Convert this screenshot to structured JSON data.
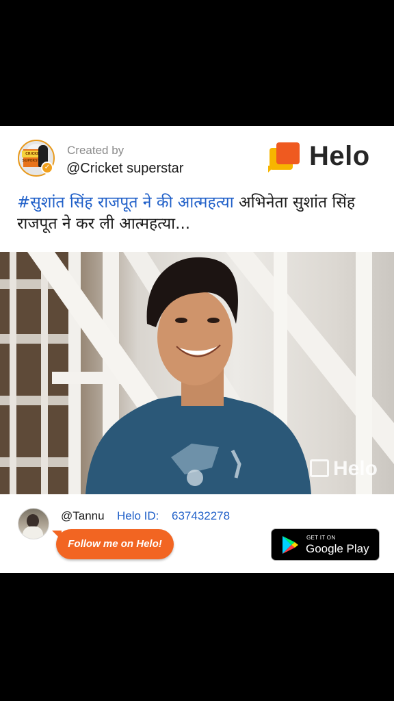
{
  "header": {
    "created_by_label": "Created by",
    "creator_handle": "@Cricket superstar",
    "avatar_banner_text": "CRICKET SUPERSTAR",
    "app_logo_text": "Helo"
  },
  "post": {
    "hashtag": "#सुशांत सिंह राजपूत ने की आत्महत्या",
    "caption_text": " अभिनेता सुशांत सिंह राजपूत ने कर ली आत्महत्या..."
  },
  "photo": {
    "watermark_text": "Helo"
  },
  "footer": {
    "user_handle": "@Tannu",
    "helo_id_label": "Helo ID:",
    "helo_id_value": "637432278",
    "follow_button_label": "Follow me on Helo!",
    "store_badge_top": "GET IT ON",
    "store_badge_name": "Google Play"
  },
  "colors": {
    "accent_orange": "#f26522",
    "link_blue": "#1f5fc8",
    "background": "#000000",
    "card": "#ffffff"
  },
  "icons": [
    "helo-logo-icon",
    "verified-badge-icon",
    "google-play-icon",
    "helo-watermark-icon"
  ]
}
